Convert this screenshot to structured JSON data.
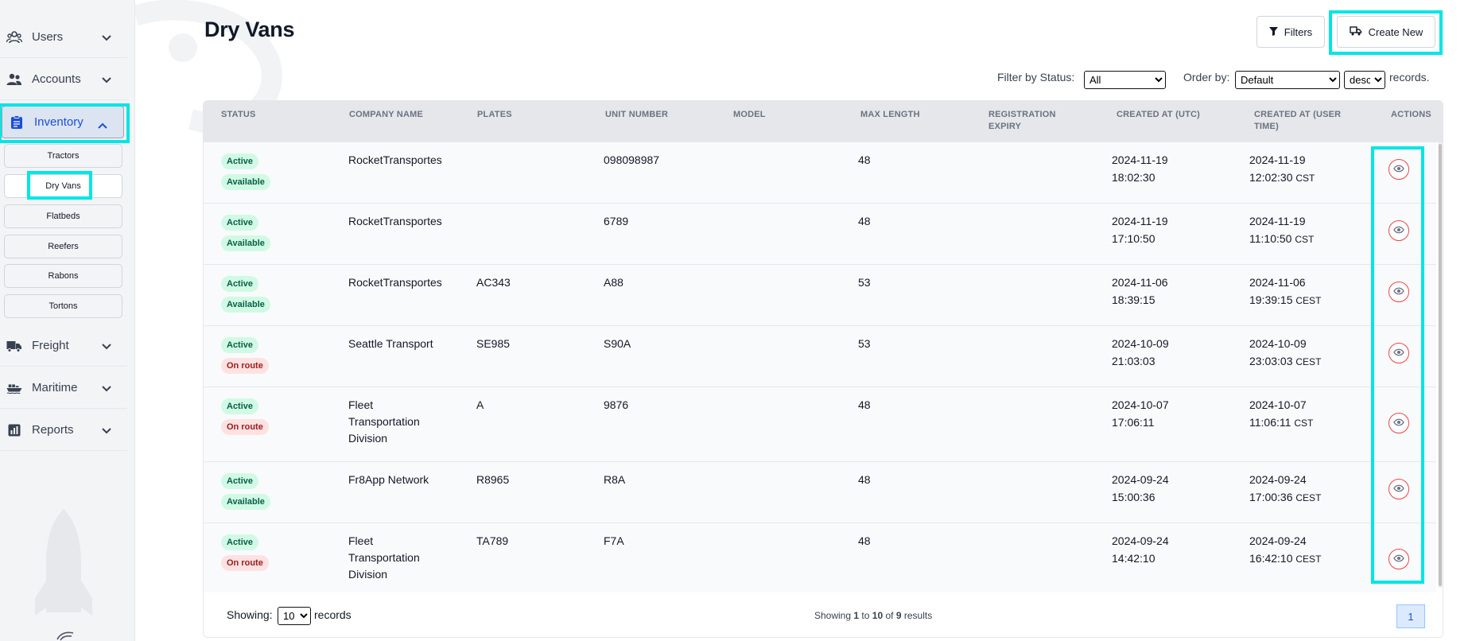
{
  "sidebar": {
    "items": [
      {
        "label": "Users"
      },
      {
        "label": "Accounts"
      },
      {
        "label": "Inventory"
      },
      {
        "label": "Freight"
      },
      {
        "label": "Maritime"
      },
      {
        "label": "Reports"
      }
    ],
    "sub_items": [
      "Tractors",
      "Dry Vans",
      "Flatbeds",
      "Reefers",
      "Rabons",
      "Tortons"
    ]
  },
  "page": {
    "title": "Dry Vans"
  },
  "toolbar": {
    "filters_label": "Filters",
    "create_label": "Create New"
  },
  "filters": {
    "status_label": "Filter by Status:",
    "status_value": "All",
    "order_label": "Order by:",
    "order_value": "Default",
    "direction_value": "desc",
    "records_suffix": "records."
  },
  "table": {
    "columns": [
      "Status",
      "Company Name",
      "Plates",
      "Unit Number",
      "Model",
      "Max Length",
      "Registration Expiry",
      "Created At (UTC)",
      "Created At (User Time)",
      "Actions"
    ],
    "rows": [
      {
        "status": "Active",
        "availability": "Available",
        "company": "RocketTransportes",
        "plates": "",
        "unit": "098098987",
        "model": "",
        "max_length": "48",
        "reg_expiry": "",
        "created_utc_date": "2024-11-19",
        "created_utc_time": "18:02:30",
        "created_user_date": "2024-11-19",
        "created_user_time": "12:02:30",
        "created_user_tz": "CST"
      },
      {
        "status": "Active",
        "availability": "Available",
        "company": "RocketTransportes",
        "plates": "",
        "unit": "6789",
        "model": "",
        "max_length": "48",
        "reg_expiry": "",
        "created_utc_date": "2024-11-19",
        "created_utc_time": "17:10:50",
        "created_user_date": "2024-11-19",
        "created_user_time": "11:10:50",
        "created_user_tz": "CST"
      },
      {
        "status": "Active",
        "availability": "Available",
        "company": "RocketTransportes",
        "plates": "AC343",
        "unit": "A88",
        "model": "",
        "max_length": "53",
        "reg_expiry": "",
        "created_utc_date": "2024-11-06",
        "created_utc_time": "18:39:15",
        "created_user_date": "2024-11-06",
        "created_user_time": "19:39:15",
        "created_user_tz": "CEST"
      },
      {
        "status": "Active",
        "availability": "On route",
        "company": "Seattle Transport",
        "plates": "SE985",
        "unit": "S90A",
        "model": "",
        "max_length": "53",
        "reg_expiry": "",
        "created_utc_date": "2024-10-09",
        "created_utc_time": "21:03:03",
        "created_user_date": "2024-10-09",
        "created_user_time": "23:03:03",
        "created_user_tz": "CEST"
      },
      {
        "status": "Active",
        "availability": "On route",
        "company": "Fleet Transportation Division",
        "plates": "A",
        "unit": "9876",
        "model": "",
        "max_length": "48",
        "reg_expiry": "",
        "created_utc_date": "2024-10-07",
        "created_utc_time": "17:06:11",
        "created_user_date": "2024-10-07",
        "created_user_time": "11:06:11",
        "created_user_tz": "CST"
      },
      {
        "status": "Active",
        "availability": "Available",
        "company": "Fr8App Network",
        "plates": "R8965",
        "unit": "R8A",
        "model": "",
        "max_length": "48",
        "reg_expiry": "",
        "created_utc_date": "2024-09-24",
        "created_utc_time": "15:00:36",
        "created_user_date": "2024-09-24",
        "created_user_time": "17:00:36",
        "created_user_tz": "CEST"
      },
      {
        "status": "Active",
        "availability": "On route",
        "company": "Fleet Transportation Division",
        "plates": "TA789",
        "unit": "F7A",
        "model": "",
        "max_length": "48",
        "reg_expiry": "",
        "created_utc_date": "2024-09-24",
        "created_utc_time": "14:42:10",
        "created_user_date": "2024-09-24",
        "created_user_time": "16:42:10",
        "created_user_tz": "CEST"
      }
    ]
  },
  "footer": {
    "showing_label": "Showing:",
    "page_size": "10",
    "records_label": "records",
    "summary_prefix": "Showing",
    "from": "1",
    "to_label": "to",
    "to": "10",
    "of_label": "of",
    "total": "9",
    "results_label": "results",
    "current_page": "1"
  },
  "colors": {
    "accent": "#1d4ed8",
    "highlight": "#00e5e5",
    "active_badge_bg": "#d1fae5",
    "active_badge_text": "#065f46",
    "onroute_badge_bg": "#fee2e2",
    "onroute_badge_text": "#991b1b",
    "action_icon": "#ef4444"
  }
}
